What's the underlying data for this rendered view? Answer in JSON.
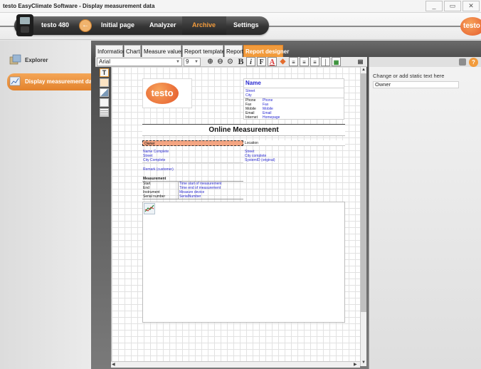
{
  "window": {
    "title": "testo EasyClimate Software - Display measurement data",
    "buttons": [
      "_",
      "▭",
      "✕"
    ]
  },
  "nav": {
    "device": "testo 480",
    "tabs": [
      "Initial page",
      "Analyzer",
      "Archive",
      "Settings"
    ],
    "active_tab": "Archive",
    "logo": "testo"
  },
  "sidebar": {
    "items": [
      {
        "label": "Explorer",
        "icon": "explorer-icon"
      },
      {
        "label": "Display measurement data",
        "icon": "display-data-icon"
      }
    ]
  },
  "tabs": [
    "Information",
    "Chart",
    "Measure values",
    "Report template",
    "Report",
    "Report designer"
  ],
  "active_tab": "Report designer",
  "toolbar": {
    "font": "Arial",
    "size": "9"
  },
  "right_panel": {
    "label": "Change or add static text here",
    "value": "Owner"
  },
  "report": {
    "logo": "testo",
    "company": {
      "name": "Name",
      "street": "Street",
      "city": "City",
      "rows": [
        {
          "k": "Phone",
          "v": "Phone"
        },
        {
          "k": "Fax",
          "v": "Fax"
        },
        {
          "k": "Mobile",
          "v": "Mobile"
        },
        {
          "k": "Email",
          "v": "Email"
        },
        {
          "k": "Internet",
          "v": "Homepage"
        }
      ]
    },
    "title": "Online Measurement",
    "owner": "Owner",
    "location": "Location",
    "left_block": [
      "Name Complete",
      "Street",
      "City Complete"
    ],
    "right_block": [
      "Street",
      "City complete",
      "SystemID (original)"
    ],
    "remark": "Remark (customer)",
    "measurement": {
      "heading": "Measurement",
      "rows": [
        {
          "k": "Start",
          "v": "Time start of measurement"
        },
        {
          "k": "End",
          "v": "Time end of measurement"
        },
        {
          "k": "Instrument",
          "v": "Measure device"
        },
        {
          "k": "Serial number",
          "v": "SerialNumber"
        }
      ]
    }
  }
}
